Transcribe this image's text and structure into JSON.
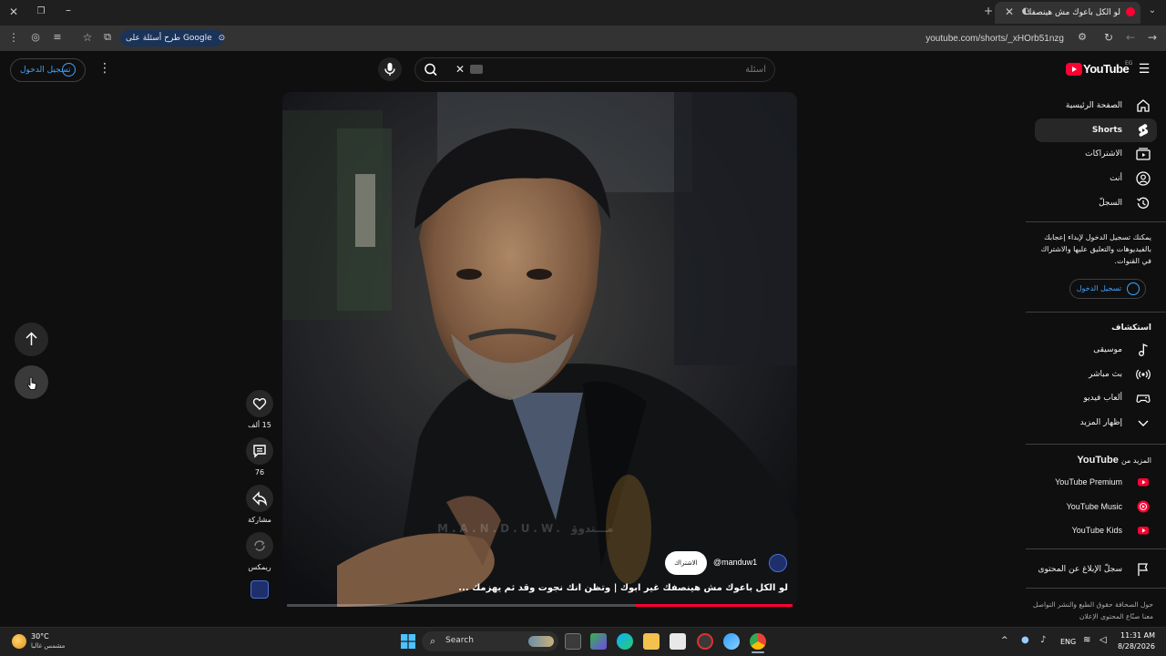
{
  "browser": {
    "tab_title": "لو الكل باعوك مش هينصفك",
    "url": "youtube.com/shorts/_xHOrb51nzg",
    "google_chip_label": "طرح أسئلة على Google",
    "new_tab": "+",
    "close_tab": "×"
  },
  "header": {
    "signin_label": "تسجيل الدخول",
    "search_placeholder": "أسئلة",
    "search_value": "",
    "logo_text": "YouTube",
    "country_code": "EG"
  },
  "sidebar": {
    "items": [
      {
        "label": "الصفحة الرئيسية",
        "icon": "home-icon"
      },
      {
        "label": "Shorts",
        "icon": "shorts-icon",
        "active": true
      },
      {
        "label": "الاشتراكات",
        "icon": "subscriptions-icon"
      },
      {
        "label": "أنت",
        "icon": "you-icon"
      },
      {
        "label": "السجلّ",
        "icon": "history-icon"
      }
    ],
    "promo_text": "يمكنك تسجيل الدخول لإبداء إعجابك بالفيديوهات والتعليق عليها والاشتراك في القنوات.",
    "signin_label": "تسجيل الدخول",
    "explore_title": "استكشاف",
    "explore_items": [
      {
        "label": "موسيقى",
        "icon": "music-icon"
      },
      {
        "label": "بث مباشر",
        "icon": "live-icon"
      },
      {
        "label": "ألعاب فيديو",
        "icon": "gaming-icon"
      },
      {
        "label": "إظهار المزيد",
        "icon": "chevron-down-icon"
      }
    ],
    "more_title_prefix": "المزيد من",
    "more_title_brand": "YouTube",
    "more_items": [
      {
        "label": "YouTube Premium",
        "icon": "yt-premium-icon"
      },
      {
        "label": "YouTube Music",
        "icon": "yt-music-icon"
      },
      {
        "label": "YouTube Kids",
        "icon": "yt-kids-icon"
      }
    ],
    "report_label": "سجلّ الإبلاغ عن المحتوى",
    "footer_links": "حول الصحافة حقوق الطبع والنشر التواصل معنا صنّاع المحتوى الإعلان"
  },
  "short": {
    "channel_handle": "@manduw1",
    "subscribe_label": "الاشتراك",
    "title": "لو الكل باعوك مش هينصفك غير ابوك | وتظن انك نجوت وقد ثم يهزمك ...",
    "watermark": "M.A.N.D.U.W. مـــتدوۆ",
    "progress": 0.31,
    "actions": {
      "likes": "15 ألف",
      "comments": "76",
      "share": "مشاركة",
      "remix": "ريمكس"
    }
  },
  "taskbar": {
    "weather_temp": "30°C",
    "weather_desc": "مشمس غالبا",
    "search_label": "Search",
    "lang": "ENG",
    "time": "11:31 AM",
    "date": "8/28/2026"
  },
  "colors": {
    "youtube_red": "#ff0033",
    "link_blue": "#3ea6ff",
    "background": "#0f0f0f"
  }
}
